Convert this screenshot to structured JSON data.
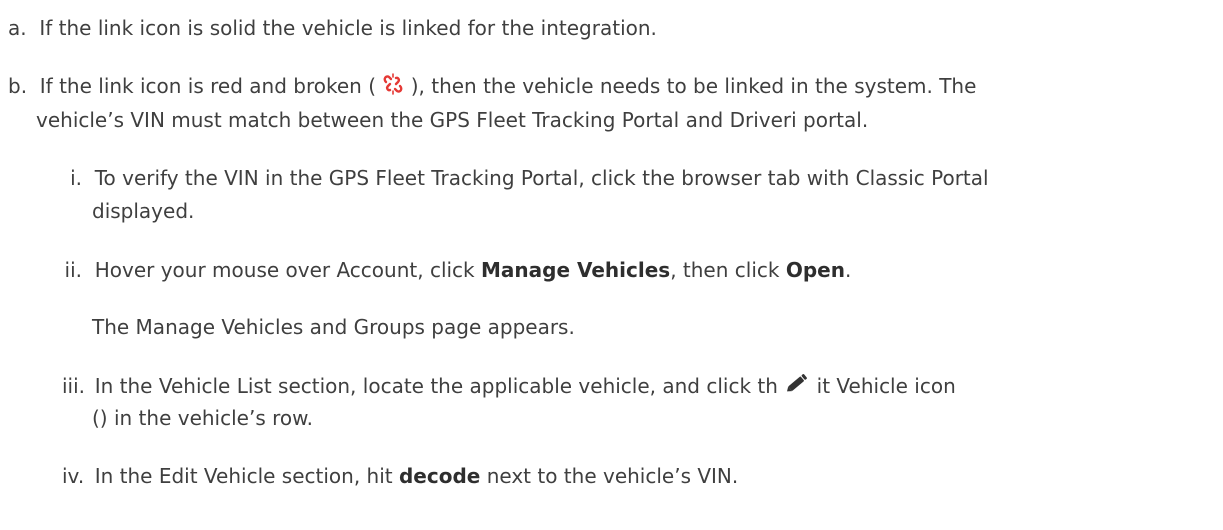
{
  "list_a": {
    "marker": "a.",
    "text": "If the link icon is solid the vehicle is linked for the integration."
  },
  "list_b": {
    "marker": "b.",
    "text_before_icon": "If the link icon is red and broken (",
    "text_after_icon": "), then the vehicle needs to be linked in the system. The",
    "text_line2": "vehicle’s VIN must match between the GPS Fleet Tracking Portal and Driveri portal.",
    "broken_link_icon": "broken-link-icon",
    "broken_link_color": "#e53935"
  },
  "step_i": {
    "marker": "i.",
    "text_line1": "To verify the VIN in the GPS Fleet Tracking Portal, click the browser tab with Classic Portal",
    "text_line2": "displayed."
  },
  "step_ii": {
    "marker": "ii.",
    "text_a": "Hover your mouse over Account, click ",
    "bold_1": "Manage Vehicles",
    "text_b": ", then click ",
    "bold_2": "Open",
    "text_c": ".",
    "result": "The Manage Vehicles and Groups page appears."
  },
  "step_iii": {
    "marker": "iii.",
    "text_before_icon": "In the Vehicle List section, locate the applicable vehicle, and click th",
    "text_after_icon": "it Vehicle icon",
    "text_line2": "() in the vehicle’s row.",
    "pencil_icon": "pencil-icon",
    "pencil_color": "#333333"
  },
  "step_iv": {
    "marker": "iv.",
    "text_a": "In the Edit Vehicle section, hit ",
    "bold": "decode",
    "text_b": " next to the vehicle’s VIN."
  }
}
